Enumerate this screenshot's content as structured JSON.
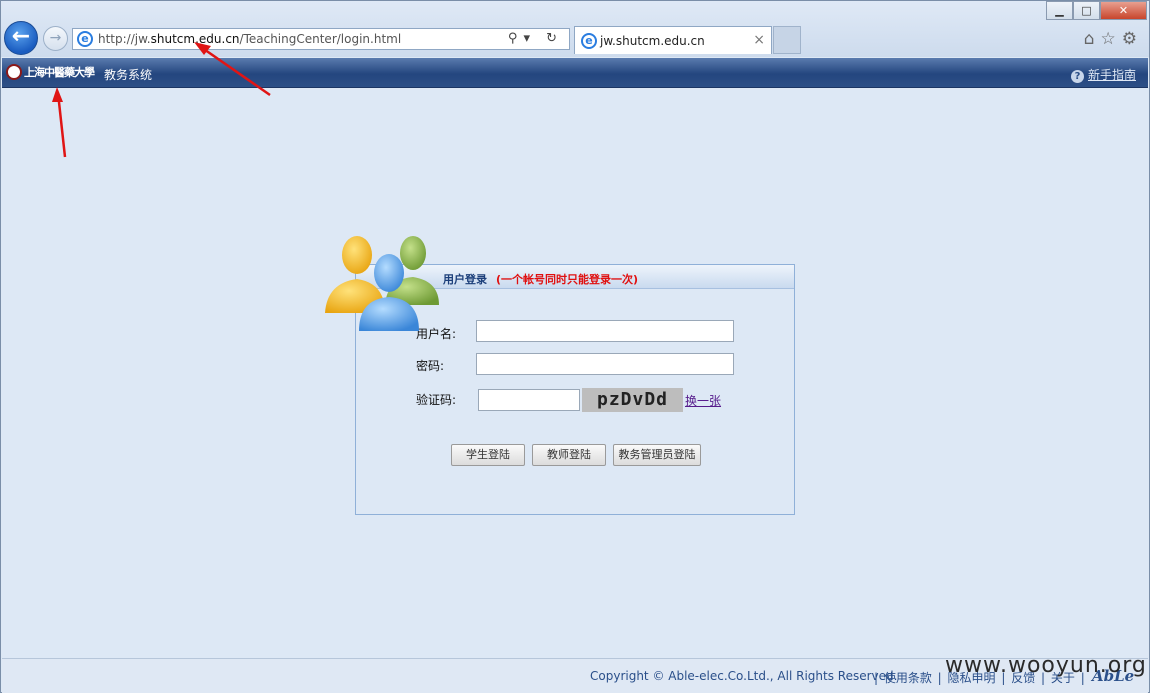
{
  "browser": {
    "url_prefix": "http://jw.",
    "url_domain": "shutcm.edu.cn",
    "url_path": "/TeachingCenter/login.html",
    "address_tools": "⚲▾ ↻",
    "tab_title": "jw.shutcm.edu.cn",
    "tab_close": "×",
    "back_glyph": "←",
    "forward_glyph": "→",
    "window_buttons": {
      "minimize": "▁",
      "maximize": "□",
      "close": "✕"
    },
    "right_icons": "⌂☆⚙"
  },
  "header": {
    "university_logo_text": "上海中醫藥大學",
    "system_name": "教务系统",
    "help_icon": "?",
    "help_link": "新手指南"
  },
  "login": {
    "title": "用户登录",
    "notice": "(一个帐号同时只能登录一次)",
    "username_label": "用户名:",
    "password_label": "密码:",
    "captcha_label": "验证码:",
    "username_value": "",
    "password_value": "",
    "captcha_value": "",
    "captcha_text": "pzDvDd",
    "refresh_link": "换一张",
    "buttons": {
      "student": "学生登陆",
      "teacher": "教师登陆",
      "admin": "教务管理员登陆"
    }
  },
  "footer": {
    "copyright": "Copyright © Able-elec.Co.Ltd., All Rights Reserved.",
    "links": "| 使用条款 | 隐私申明 | 反馈 | 关于 |",
    "brand": "AbLe"
  },
  "watermark": "www.wooyun.org",
  "colors": {
    "header_bar": "#24467f",
    "page_bg": "#dde8f5",
    "notice_red": "#e01010",
    "annotation_arrow": "#e01515"
  }
}
